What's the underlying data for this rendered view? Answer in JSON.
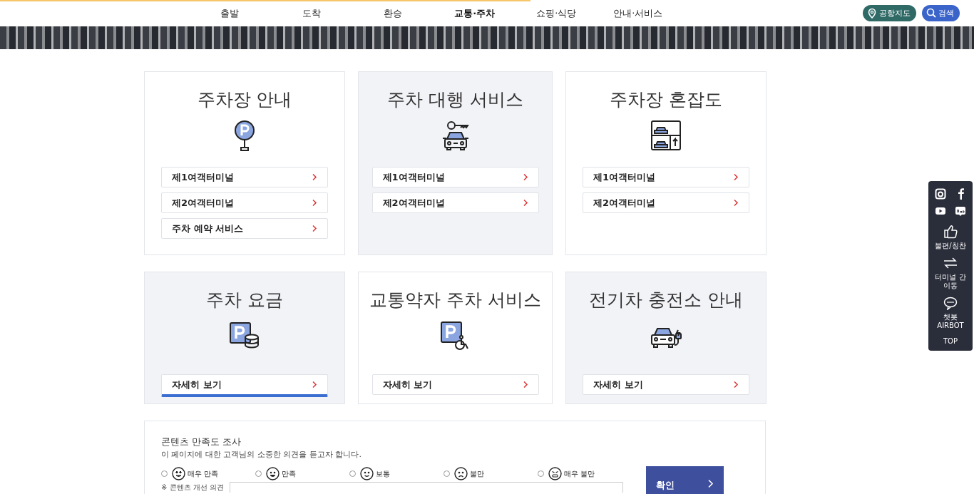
{
  "header": {
    "progress": {
      "level": 0.545
    },
    "nav": [
      {
        "label": "출발",
        "selected": false
      },
      {
        "label": "도착",
        "selected": false
      },
      {
        "label": "환승",
        "selected": false
      },
      {
        "label": "교통·주차",
        "selected": true
      },
      {
        "label": "쇼핑·식당",
        "selected": false
      },
      {
        "label": "안내·서비스",
        "selected": false
      }
    ],
    "buttons": [
      {
        "kind": "map",
        "label": "공항지도"
      },
      {
        "kind": "search",
        "label": "검색"
      }
    ]
  },
  "cards": [
    {
      "title": "주차장 안내",
      "kind": "parking-sign",
      "shaded": false,
      "links": [
        {
          "label": "제1여객터미널",
          "focused": false
        },
        {
          "label": "제2여객터미널",
          "focused": false
        },
        {
          "label": "주차 예약 서비스",
          "focused": false
        }
      ]
    },
    {
      "title": "주차 대행 서비스",
      "kind": "car-key",
      "shaded": true,
      "links": [
        {
          "label": "제1여객터미널",
          "focused": false
        },
        {
          "label": "제2여객터미널",
          "focused": false
        }
      ]
    },
    {
      "title": "주차장 혼잡도",
      "kind": "parking-lot",
      "shaded": false,
      "links": [
        {
          "label": "제1여객터미널",
          "focused": false
        },
        {
          "label": "제2여객터미널",
          "focused": false
        }
      ]
    },
    {
      "title": "주차 요금",
      "kind": "parking-fee",
      "shaded": true,
      "links": [
        {
          "label": "자세히 보기",
          "focused": true
        }
      ]
    },
    {
      "title": "교통약자 주차 서비스",
      "kind": "accessible",
      "shaded": false,
      "links": [
        {
          "label": "자세히 보기",
          "focused": false
        }
      ]
    },
    {
      "title": "전기차 충전소 안내",
      "kind": "ev-car",
      "shaded": true,
      "links": [
        {
          "label": "자세히 보기",
          "focused": false
        }
      ]
    }
  ],
  "survey": {
    "title": "콘텐츠 만족도 조사",
    "subtitle": "이 페이지에 대한 고객님의 소중한 의견을 듣고자 합니다.",
    "options": [
      {
        "label": "매우 만족",
        "kind": "love",
        "selected": false
      },
      {
        "label": "만족",
        "kind": "happy",
        "selected": false
      },
      {
        "label": "보통",
        "kind": "smile",
        "selected": false
      },
      {
        "label": "불만",
        "kind": "sad",
        "selected": false
      },
      {
        "label": "매우 불만",
        "kind": "angry",
        "selected": false
      }
    ],
    "field_label": "※ 콘텐츠 개선 의견",
    "submit": "확인"
  },
  "side_panel": {
    "items": [
      {
        "kind": "like",
        "label": "불편/칭찬"
      },
      {
        "kind": "swap",
        "label": "터미널 간 이동"
      },
      {
        "kind": "chat",
        "label": "챗봇 AIRBOT"
      }
    ],
    "top": "TOP"
  }
}
